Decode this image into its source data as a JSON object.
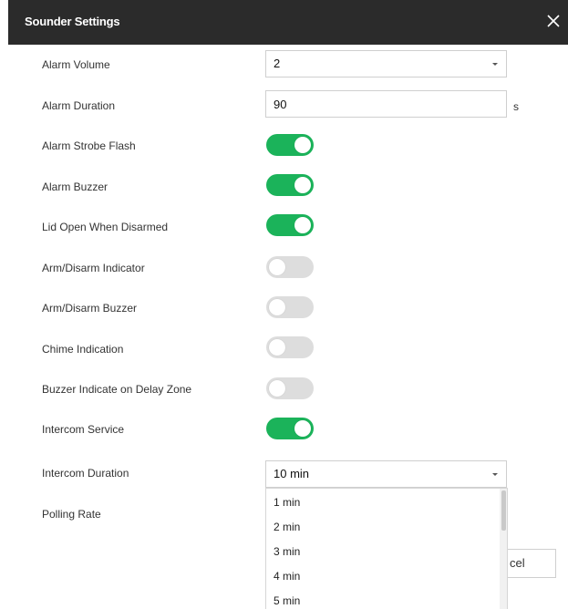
{
  "dialog": {
    "title": "Sounder Settings"
  },
  "fields": {
    "alarm_volume": {
      "label": "Alarm Volume",
      "value": "2"
    },
    "alarm_duration": {
      "label": "Alarm Duration",
      "value": "90",
      "unit": "s"
    },
    "alarm_strobe_flash": {
      "label": "Alarm Strobe Flash",
      "enabled": true
    },
    "alarm_buzzer": {
      "label": "Alarm Buzzer",
      "enabled": true
    },
    "lid_open_when_disarmed": {
      "label": "Lid Open When Disarmed",
      "enabled": true
    },
    "arm_disarm_indicator": {
      "label": "Arm/Disarm Indicator",
      "enabled": false
    },
    "arm_disarm_buzzer": {
      "label": "Arm/Disarm Buzzer",
      "enabled": false
    },
    "chime_indication": {
      "label": "Chime Indication",
      "enabled": false
    },
    "buzzer_indicate_delay_zone": {
      "label": "Buzzer Indicate on Delay Zone",
      "enabled": false
    },
    "intercom_service": {
      "label": "Intercom Service",
      "enabled": true
    },
    "intercom_duration": {
      "label": "Intercom Duration",
      "value": "10 min"
    },
    "polling_rate": {
      "label": "Polling Rate"
    }
  },
  "dropdown": {
    "options": [
      "1 min",
      "2 min",
      "3 min",
      "4 min",
      "5 min"
    ]
  },
  "buttons": {
    "cancel_label": "cel"
  },
  "colors": {
    "title_bar": "#2b2b2b",
    "toggle_on": "#1bb35a",
    "toggle_off": "#dddddd"
  }
}
